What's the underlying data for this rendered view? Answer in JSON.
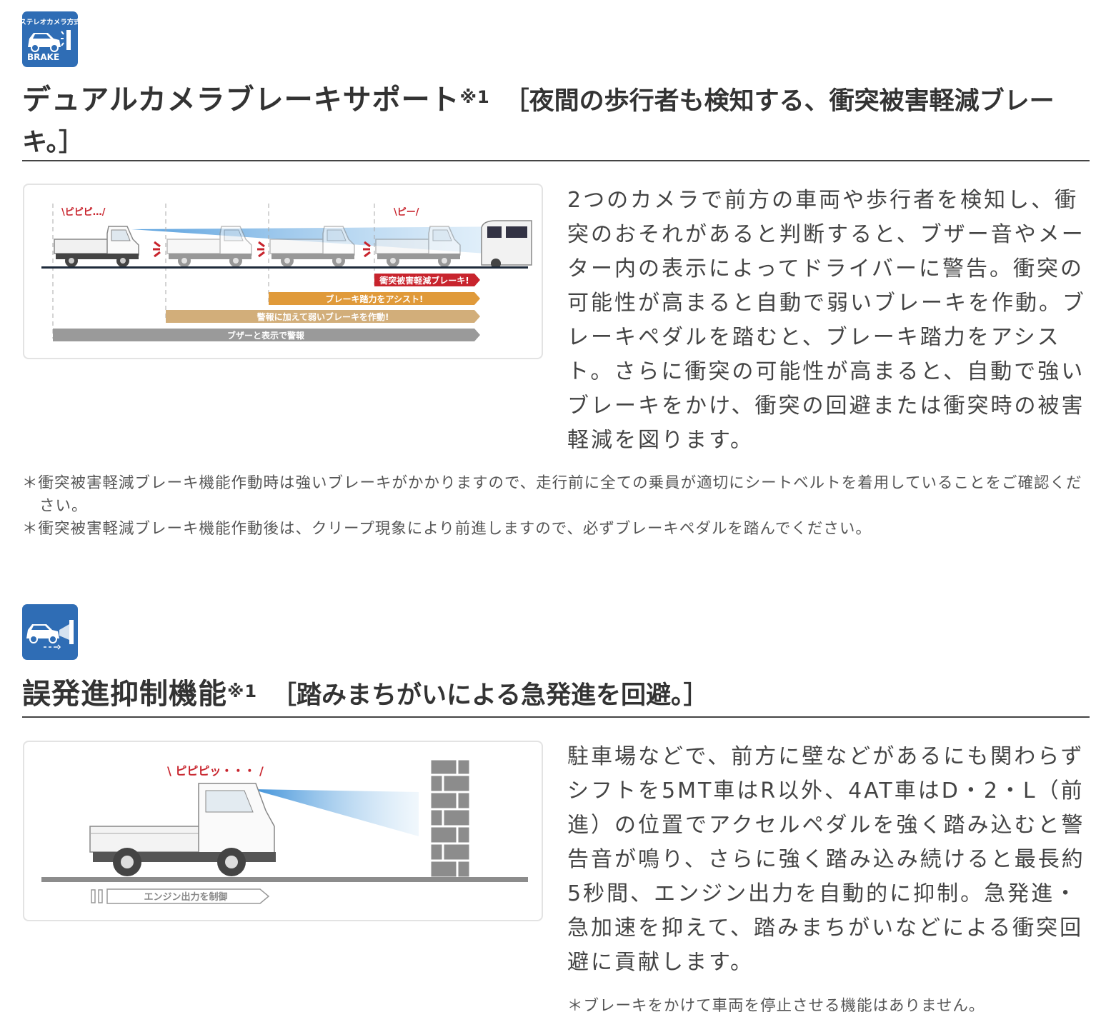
{
  "section1": {
    "badge": {
      "top_text": "ステレオカメラ方式",
      "bottom_text": "BRAKE",
      "icon": "stereo-camera-brake-icon"
    },
    "title": "デュアルカメラブレーキサポート",
    "title_sup": "※1",
    "subtitle": "［夜間の歩行者も検知する、衝突被害軽減ブレーキ。］",
    "figure": {
      "sound1": "\\ピピピ…/",
      "sound2": "\\ピー/",
      "bars": [
        {
          "label": "衝突被害軽減ブレーキ!",
          "color": "#c8242d"
        },
        {
          "label": "ブレーキ踏力をアシスト!",
          "color": "#e09a3a"
        },
        {
          "label": "警報に加えて弱いブレーキを作動!",
          "color": "#d2ae7a"
        },
        {
          "label": "ブザーと表示で警報",
          "color": "#9a9a9a"
        }
      ]
    },
    "paragraph": "2つのカメラで前方の車両や歩行者を検知し、衝突のおそれがあると判断すると、ブザー音やメーター内の表示によってドライバーに警告。衝突の可能性が高まると自動で弱いブレーキを作動。ブレーキペダルを踏むと、ブレーキ踏力をアシスト。さらに衝突の可能性が高まると、自動で強いブレーキをかけ、衝突の回避または衝突時の被害軽減を図ります。",
    "notes": [
      "＊衝突被害軽減ブレーキ機能作動時は強いブレーキがかかりますので、走行前に全ての乗員が適切にシートベルトを着用していることをご確認ください。",
      "＊衝突被害軽減ブレーキ機能作動後は、クリープ現象により前進しますので、必ずブレーキペダルを踏んでください。"
    ]
  },
  "section2": {
    "badge": {
      "icon": "false-start-prevention-icon"
    },
    "title": "誤発進抑制機能",
    "title_sup": "※1",
    "subtitle": "［踏みまちがいによる急発進を回避。］",
    "figure": {
      "sound": "\\ ピピピッ・・・ /",
      "bar_label": "エンジン出力を制御"
    },
    "paragraph": "駐車場などで、前方に壁などがあるにも関わらずシフトを5MT車はR以外、4AT車はD・2・L（前進）の位置でアクセルペダルを強く踏み込むと警告音が鳴り、さらに強く踏み込み続けると最長約5秒間、エンジン出力を自動的に抑制。急発進・急加速を抑えて、踏みまちがいなどによる衝突回避に貢献します。",
    "notes": [
      "＊ブレーキをかけて車両を停止させる機能はありません。"
    ]
  }
}
